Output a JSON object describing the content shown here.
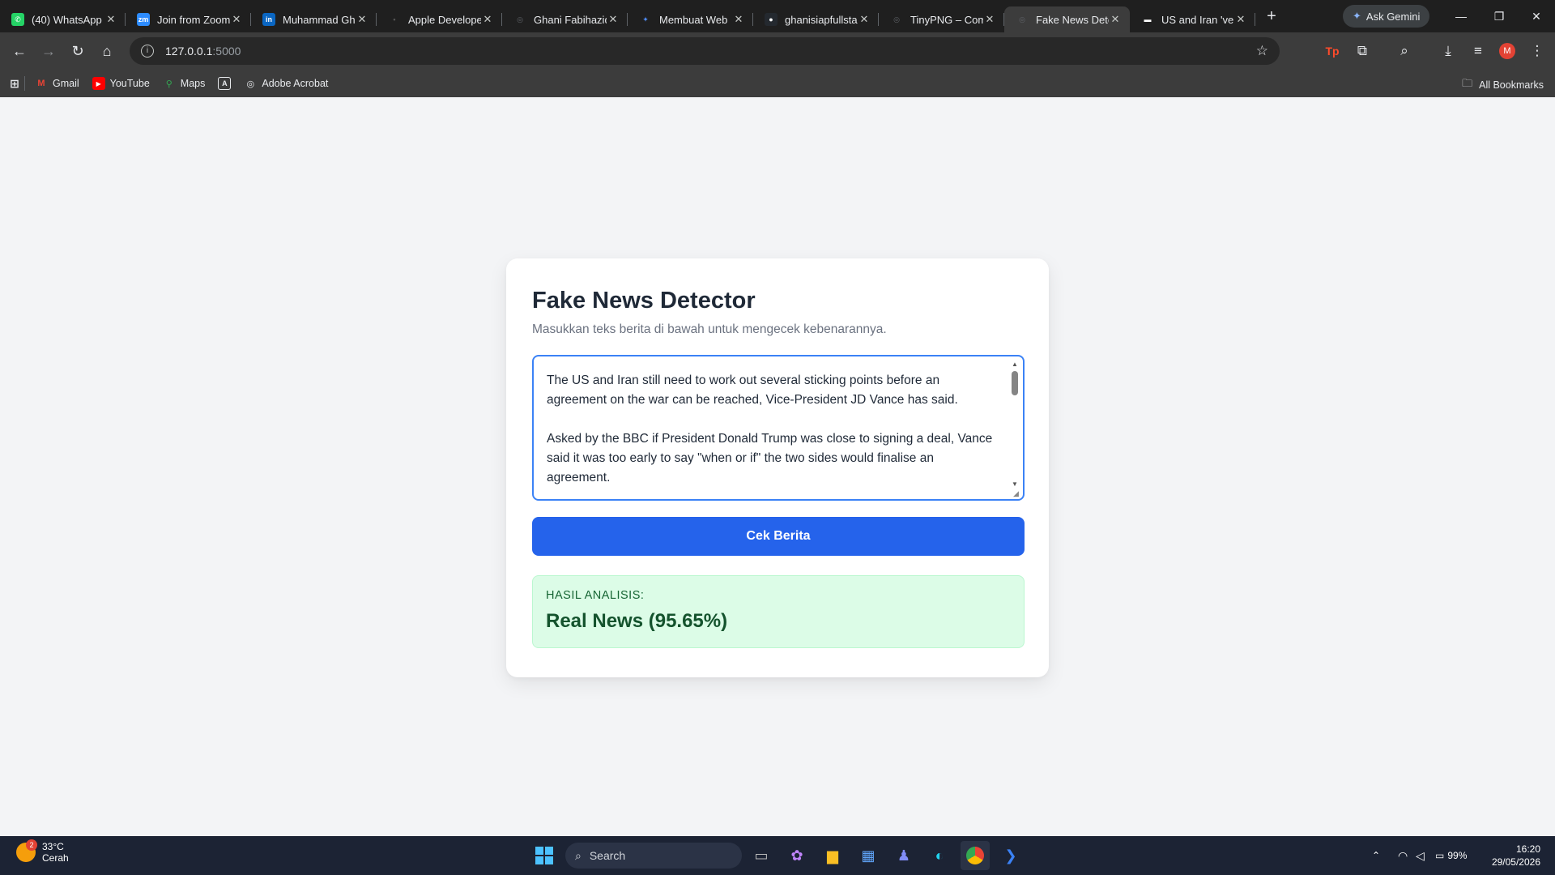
{
  "browser": {
    "tabs": [
      {
        "title": "(40) WhatsApp",
        "icon": "whatsapp-icon",
        "color": "#25d366",
        "glyph": "✆"
      },
      {
        "title": "Join from Zoom",
        "icon": "zoom-icon",
        "color": "#2d8cff",
        "glyph": "zm"
      },
      {
        "title": "Muhammad Gh",
        "icon": "linkedin-icon",
        "color": "#0a66c2",
        "glyph": "in"
      },
      {
        "title": "Apple Develope",
        "icon": "apple-icon",
        "color": "#555555",
        "glyph": "•"
      },
      {
        "title": "Ghani Fabihaziq",
        "icon": "globe-icon",
        "color": "#5f6368",
        "glyph": "◎"
      },
      {
        "title": "Membuat Web",
        "icon": "gemini-icon",
        "color": "#4f8cf7",
        "glyph": "✦"
      },
      {
        "title": "ghanisiapfullsta",
        "icon": "github-icon",
        "color": "#24292f",
        "glyph": "●"
      },
      {
        "title": "TinyPNG – Com",
        "icon": "tinypng-icon",
        "color": "#5f6368",
        "glyph": "◎"
      },
      {
        "title": "Fake News Dete",
        "icon": "globe-icon",
        "color": "#5f6368",
        "glyph": "◎",
        "active": true
      },
      {
        "title": "US and Iran 'ver",
        "icon": "bbc-icon",
        "color": "#ffffff",
        "glyph": "▬"
      }
    ],
    "gemini_label": "Ask Gemini",
    "url_host": "127.0.0.1",
    "url_port": ":5000",
    "bookmarks": [
      {
        "label": "Gmail",
        "icon": "gmail-icon"
      },
      {
        "label": "YouTube",
        "icon": "youtube-icon"
      },
      {
        "label": "Maps",
        "icon": "maps-icon"
      },
      {
        "label": "",
        "icon": "acrobat-app-icon"
      },
      {
        "label": "Adobe Acrobat",
        "icon": "acrobat-icon"
      }
    ],
    "all_bookmarks": "All Bookmarks",
    "profile_initial": "M"
  },
  "page": {
    "title": "Fake News Detector",
    "subtitle": "Masukkan teks berita di bawah untuk mengecek kebenarannya.",
    "news_text": "The US and Iran still need to work out several sticking points before an agreement on the war can be reached, Vice-President JD Vance has said.\n\nAsked by the BBC if President Donald Trump was close to signing a deal, Vance said it was too early to say \"when or if\" the two sides would finalise an agreement.",
    "check_button": "Cek Berita",
    "result_label": "HASIL ANALISIS:",
    "result_value": "Real News (95.65%)"
  },
  "taskbar": {
    "temperature": "33°C",
    "condition": "Cerah",
    "weather_badge": "2",
    "search_placeholder": "Search",
    "battery": "99%",
    "time": "16:20",
    "date": "29/05/2026"
  },
  "colors": {
    "primary_button": "#2563eb",
    "result_bg": "#dcfce7",
    "result_text": "#14532d"
  }
}
